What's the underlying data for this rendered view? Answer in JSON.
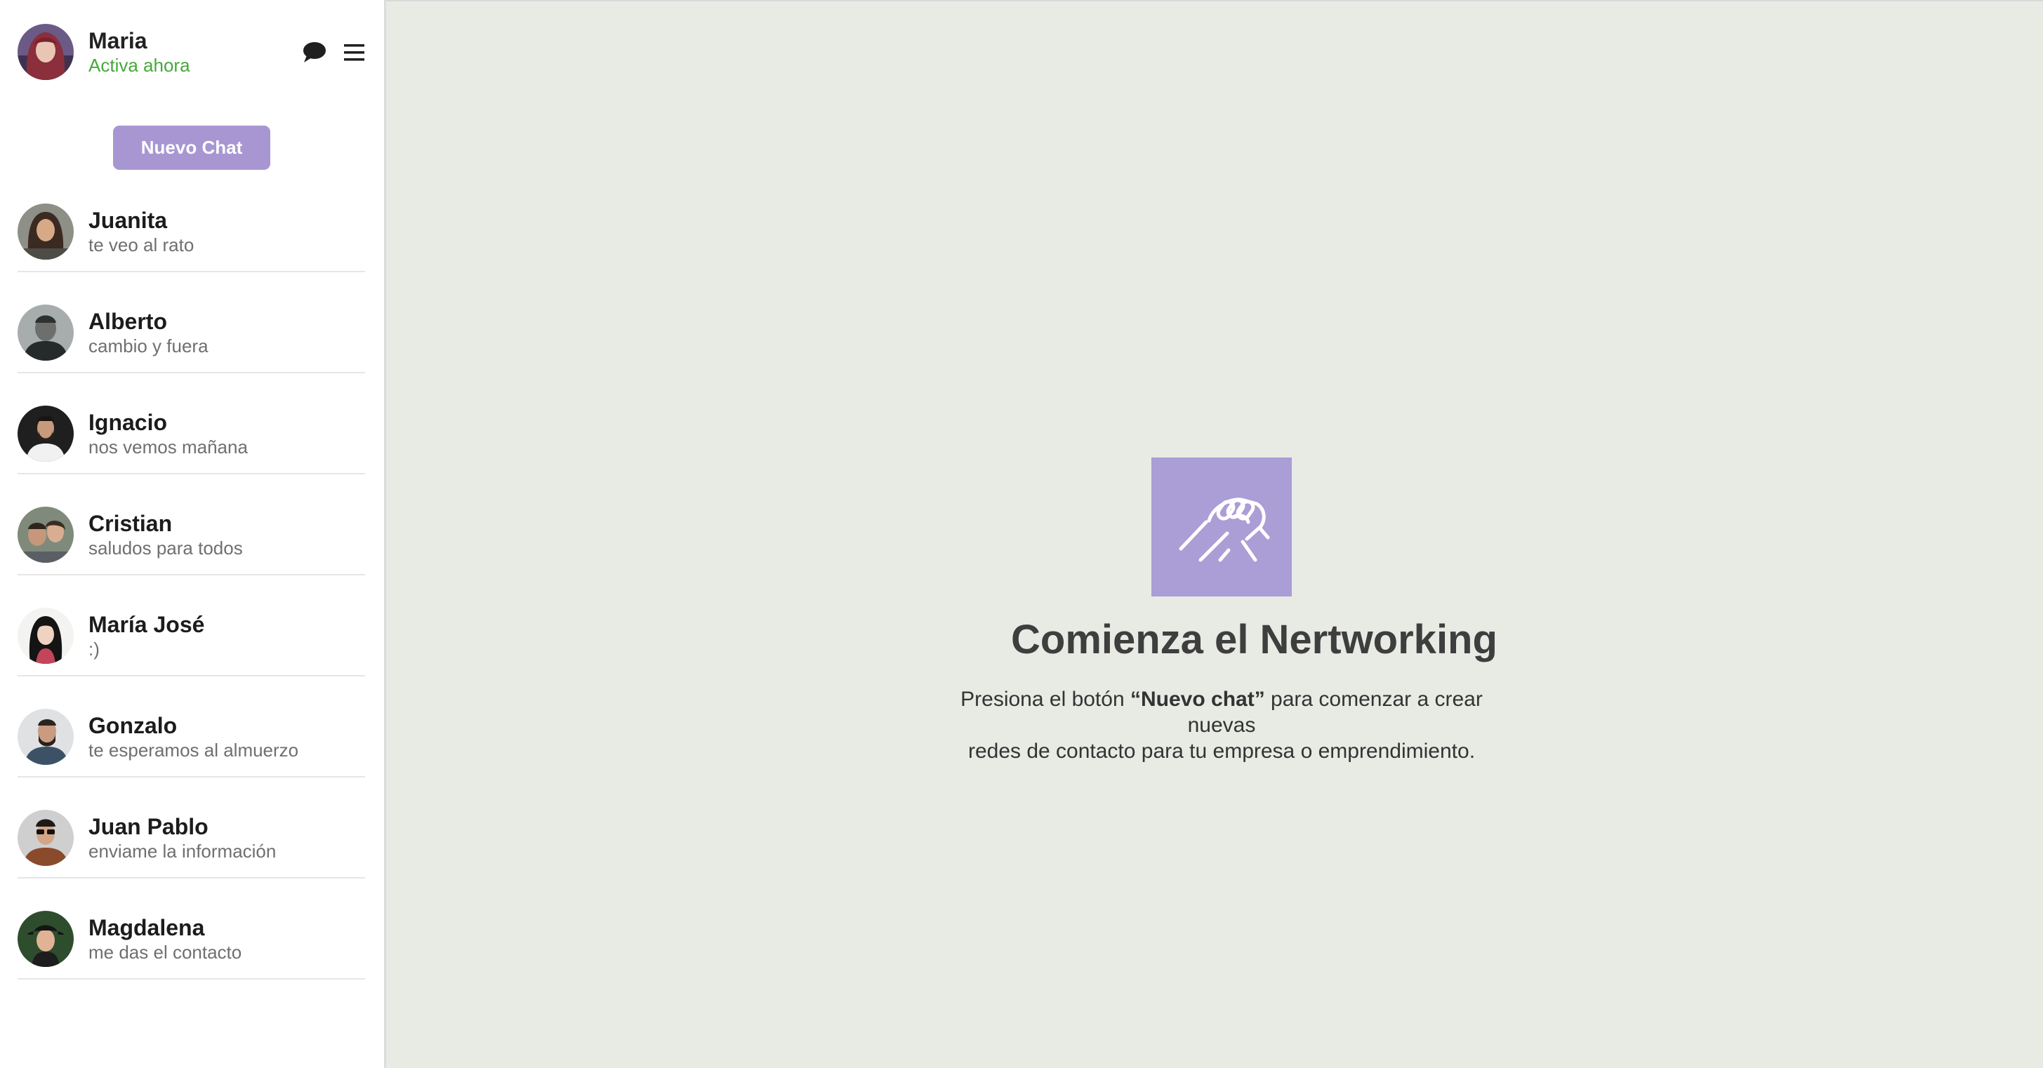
{
  "profile": {
    "name": "Maria",
    "status": "Activa ahora"
  },
  "header_icons": [
    "chat-bubble-icon",
    "menu-icon"
  ],
  "new_chat_label": "Nuevo Chat",
  "contacts": [
    {
      "name": "Juanita",
      "last_message": "te veo al rato"
    },
    {
      "name": "Alberto",
      "last_message": "cambio y fuera"
    },
    {
      "name": "Ignacio",
      "last_message": "nos vemos mañana"
    },
    {
      "name": "Cristian",
      "last_message": "saludos para todos"
    },
    {
      "name": "María José",
      "last_message": ":)"
    },
    {
      "name": "Gonzalo",
      "last_message": "te esperamos al almuerzo"
    },
    {
      "name": "Juan Pablo",
      "last_message": "enviame la información"
    },
    {
      "name": "Magdalena",
      "last_message": "me das el contacto"
    }
  ],
  "empty_state": {
    "icon": "handshake-icon",
    "title": "Comienza el Nertworking",
    "text_before": "Presiona el botón ",
    "text_bold": "“Nuevo chat”",
    "text_after": " para comenzar a crear",
    "text_line2": "nuevas",
    "text_line3": "redes de contacto para tu empresa o emprendimiento."
  },
  "colors": {
    "accent": "#a896d2",
    "icon_tile": "#ab9dd5",
    "status_green": "#46a83a",
    "main_background": "#e8eae4"
  }
}
